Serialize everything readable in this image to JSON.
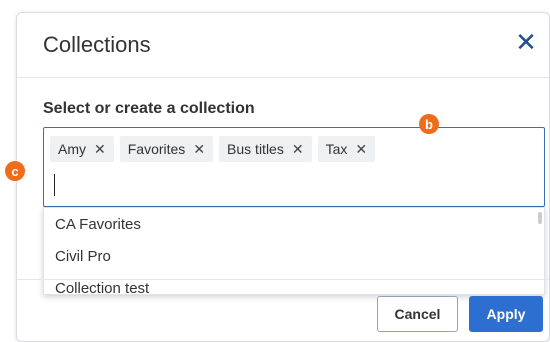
{
  "modal": {
    "title": "Collections",
    "close_icon": "close-icon"
  },
  "field": {
    "label": "Select or create a collection",
    "input_value": ""
  },
  "chips": [
    {
      "label": "Amy",
      "remove_icon": "close-icon"
    },
    {
      "label": "Favorites",
      "remove_icon": "close-icon"
    },
    {
      "label": "Bus titles",
      "remove_icon": "close-icon"
    },
    {
      "label": "Tax",
      "remove_icon": "close-icon"
    }
  ],
  "dropdown": {
    "options": [
      "CA Favorites",
      "Civil Pro",
      "Collection test"
    ]
  },
  "footer": {
    "cancel_label": "Cancel",
    "apply_label": "Apply"
  },
  "annotations": {
    "b": "b",
    "c": "c"
  },
  "colors": {
    "accent": "#2d6fd1",
    "border_focus": "#3a6fb5",
    "badge": "#ef6c1a"
  }
}
